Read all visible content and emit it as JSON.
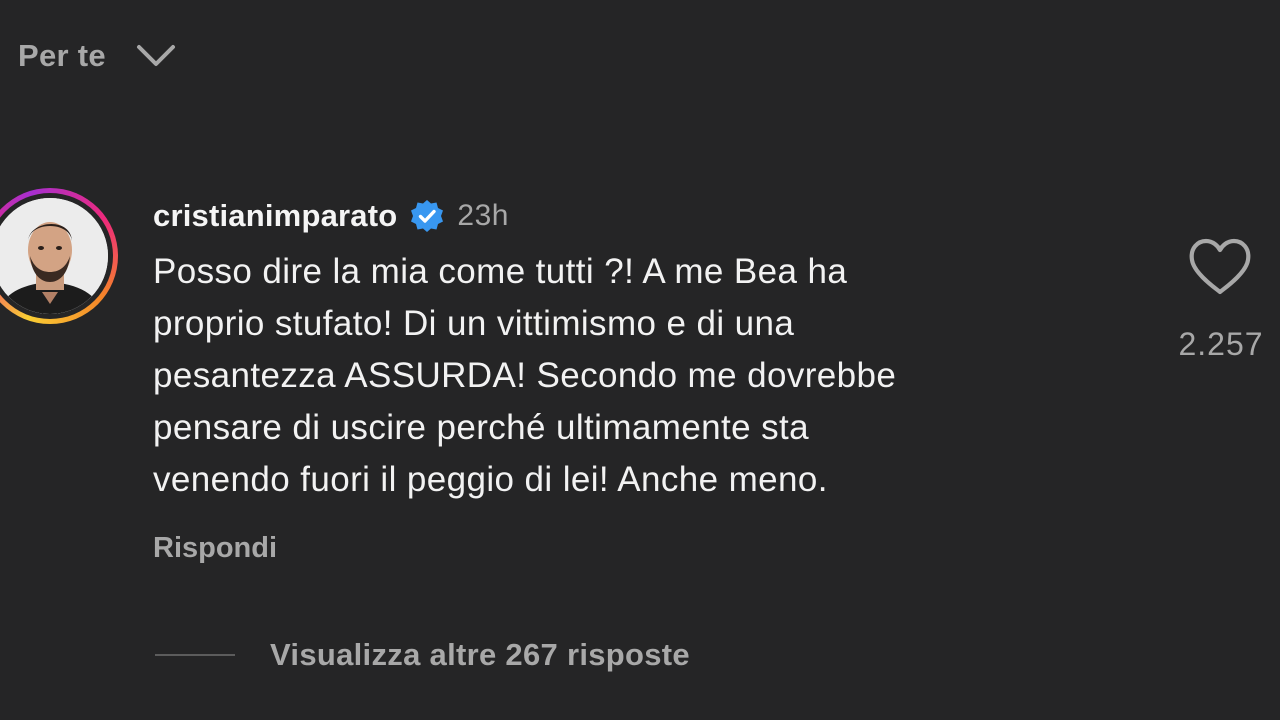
{
  "filter": {
    "label": "Per te",
    "icon": "chevron-down-icon"
  },
  "comment": {
    "username": "cristianimparato",
    "verified_icon": "verified-badge-icon",
    "time": "23h",
    "text": "Posso dire la mia come tutti ?! A me Bea ha\nproprio stufato! Di un vittimismo e di una\npesantezza ASSURDA! Secondo me dovrebbe\npensare di uscire perché ultimamente sta\nvenendo fuori il peggio di lei! Anche meno.",
    "reply_label": "Rispondi",
    "like_icon": "heart-outline-icon",
    "like_count": "2.257"
  },
  "replies": {
    "view_more_label": "Visualizza altre 267 risposte"
  },
  "colors": {
    "background": "#252526",
    "primary_text": "#f2f2f2",
    "secondary_text": "#a8a8a8",
    "verified_blue": "#3897f0"
  }
}
